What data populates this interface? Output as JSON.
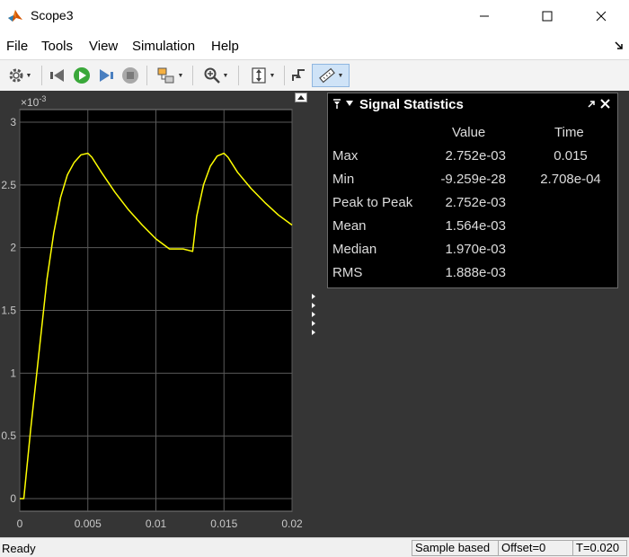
{
  "window": {
    "title": "Scope3"
  },
  "menu": [
    "File",
    "Tools",
    "View",
    "Simulation",
    "Help"
  ],
  "toolbar": {
    "icons": [
      "gear-icon",
      "step-back-icon",
      "run-icon",
      "step-forward-icon",
      "stop-icon",
      "highlight-block-icon",
      "zoom-icon",
      "scale-axes-icon",
      "triggers-icon",
      "measurements-icon"
    ]
  },
  "chart_data": {
    "type": "line",
    "title": "",
    "xlabel": "",
    "ylabel": "",
    "y_multiplier": "×10",
    "y_multiplier_exp": "-3",
    "xlim": [
      0,
      0.02
    ],
    "ylim": [
      -0.1,
      3.1
    ],
    "xticks": [
      "0",
      "0.005",
      "0.01",
      "0.015",
      "0.02"
    ],
    "xtick_values": [
      0,
      0.005,
      0.01,
      0.015,
      0.02
    ],
    "yticks": [
      "0",
      "0.5",
      "1",
      "1.5",
      "2",
      "2.5",
      "3"
    ],
    "ytick_values": [
      0,
      0.5,
      1,
      1.5,
      2,
      2.5,
      3
    ],
    "grid": true,
    "colors": {
      "background": "#000000",
      "line": "#ffff00",
      "grid": "#5a5a5a",
      "tick_text": "#c8c8c8"
    },
    "series": [
      {
        "x": [
          0,
          0.0003,
          0.0008,
          0.0015,
          0.002,
          0.0025,
          0.003,
          0.0035,
          0.004,
          0.0045,
          0.005,
          0.0053,
          0.006,
          0.007,
          0.008,
          0.009,
          0.01,
          0.011,
          0.012,
          0.0127,
          0.013,
          0.0135,
          0.014,
          0.0145,
          0.015,
          0.0153,
          0.016,
          0.017,
          0.018,
          0.019,
          0.02
        ],
        "y": [
          0,
          0,
          0.55,
          1.25,
          1.75,
          2.12,
          2.4,
          2.58,
          2.68,
          2.74,
          2.752,
          2.72,
          2.6,
          2.44,
          2.3,
          2.18,
          2.07,
          1.99,
          1.99,
          1.97,
          2.25,
          2.5,
          2.65,
          2.73,
          2.752,
          2.72,
          2.6,
          2.47,
          2.36,
          2.26,
          2.18
        ]
      }
    ]
  },
  "stats": {
    "title": "Signal Statistics",
    "headers": {
      "value": "Value",
      "time": "Time"
    },
    "rows": [
      {
        "label": "Max",
        "value": "2.752e-03",
        "time": "0.015"
      },
      {
        "label": "Min",
        "value": "-9.259e-28",
        "time": "2.708e-04"
      },
      {
        "label": "Peak to Peak",
        "value": "2.752e-03",
        "time": ""
      },
      {
        "label": "Mean",
        "value": "1.564e-03",
        "time": ""
      },
      {
        "label": "Median",
        "value": "1.970e-03",
        "time": ""
      },
      {
        "label": "RMS",
        "value": "1.888e-03",
        "time": ""
      }
    ]
  },
  "status": {
    "ready": "Ready",
    "mode": "Sample based",
    "offset": "Offset=0",
    "time": "T=0.020"
  }
}
